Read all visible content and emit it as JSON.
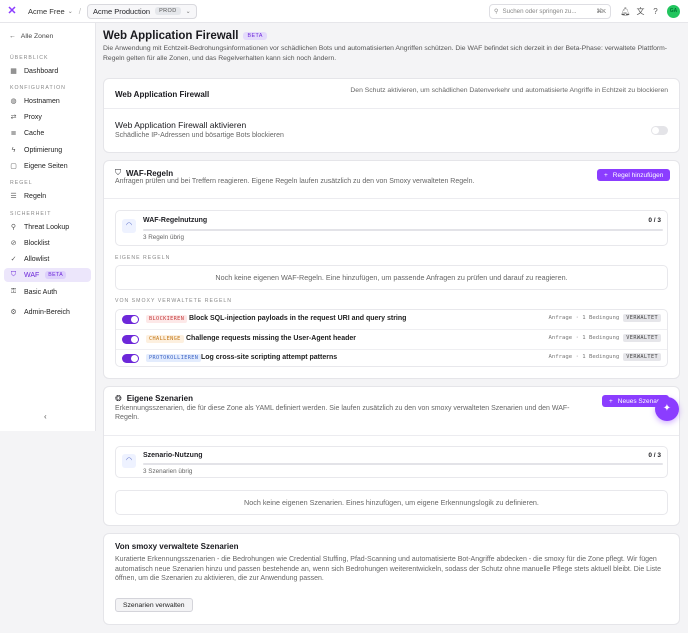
{
  "topbar": {
    "org": "Acme Free",
    "zone": "Acme Production",
    "zone_badge": "PROD",
    "search_placeholder": "Suchen oder springen zu...",
    "search_kbd": "⌘K",
    "avatar": "GA"
  },
  "sidebar": {
    "back": "Alle Zonen",
    "sections": {
      "overview": "ÜBERBLICK",
      "config": "KONFIGURATION",
      "rules": "REGEL",
      "security": "SICHERHEIT"
    },
    "items": {
      "dashboard": "Dashboard",
      "hostnames": "Hostnamen",
      "proxy": "Proxy",
      "cache": "Cache",
      "optimization": "Optimierung",
      "pages": "Eigene Seiten",
      "rules": "Regeln",
      "threat": "Threat Lookup",
      "blocklist": "Blocklist",
      "allowlist": "Allowlist",
      "waf": "WAF",
      "waf_badge": "BETA",
      "basic_auth": "Basic Auth",
      "admin": "Admin-Bereich"
    }
  },
  "page": {
    "title": "Web Application Firewall",
    "title_badge": "BETA",
    "intro": "Die Anwendung mit Echtzeit-Bedrohungsinformationen vor schädlichen Bots und automatisierten Angriffen schützen. Die WAF befindet sich derzeit in der Beta-Phase: verwaltete Plattform-Regeln gelten für alle Zonen, und das Regelverhalten kann sich noch ändern."
  },
  "waf_card": {
    "title": "Web Application Firewall",
    "subtitle": "Den Schutz aktivieren, um schädlichen Datenverkehr und automatisierte Angriffe in Echtzeit zu blockieren",
    "toggle_title": "Web Application Firewall aktivieren",
    "toggle_desc": "Schädliche IP-Adressen und bösartige Bots blockieren",
    "enabled": false
  },
  "rules_card": {
    "title": "WAF-Regeln",
    "desc": "Anfragen prüfen und bei Treffern reagieren. Eigene Regeln laufen zusätzlich zu den von Smoxy verwalteten Regeln.",
    "add_button": "Regel hinzufügen",
    "usage_title": "WAF-Regelnutzung",
    "usage_count": "0 / 3",
    "usage_remaining": "3 Regeln übrig",
    "usage_fraction": 0,
    "own_label": "EIGENE REGELN",
    "own_empty": "Noch keine eigenen WAF-Regeln. Eine hinzufügen, um passende Anfragen zu prüfen und darauf zu reagieren.",
    "managed_label": "VON SMOXY VERWALTETE REGELN",
    "managed_rules": [
      {
        "action": "BLOCKIEREN",
        "title": "Block SQL-injection payloads in the request URI and query string",
        "meta": "Anfrage · 1 Bedingung",
        "badge": "VERWALTET"
      },
      {
        "action": "CHALLENGE",
        "title": "Challenge requests missing the User-Agent header",
        "meta": "Anfrage · 1 Bedingung",
        "badge": "VERWALTET"
      },
      {
        "action": "PROTOKOLLIEREN",
        "title": "Log cross-site scripting attempt patterns",
        "meta": "Anfrage · 1 Bedingung",
        "badge": "VERWALTET"
      }
    ]
  },
  "scenarios_card": {
    "title": "Eigene Szenarien",
    "desc": "Erkennungsszenarien, die für diese Zone als YAML definiert werden. Sie laufen zusätzlich zu den von smoxy verwalteten Szenarien und den WAF-Regeln.",
    "new_button": "Neues Szenar",
    "usage_title": "Szenario-Nutzung",
    "usage_count": "0 / 3",
    "usage_remaining": "3 Szenarien übrig",
    "usage_fraction": 0,
    "empty": "Noch keine eigenen Szenarien. Eines hinzufügen, um eigene Erkennungslogik zu definieren."
  },
  "managed_scenarios": {
    "title": "Von smoxy verwaltete Szenarien",
    "desc": "Kuratierte Erkennungsszenarien - die Bedrohungen wie Credential Stuffing, Pfad-Scanning und automatisierte Bot-Angriffe abdecken - die smoxy für die Zone pflegt. Wir fügen automatisch neue Szenarien hinzu und passen bestehende an, wenn sich Bedrohungen weiterentwickeln, sodass der Schutz ohne manuelle Pflege stets aktuell bleibt. Die Liste öffnen, um die Szenarien zu aktivieren, die zur Anwendung passen.",
    "button": "Szenarien verwalten"
  }
}
